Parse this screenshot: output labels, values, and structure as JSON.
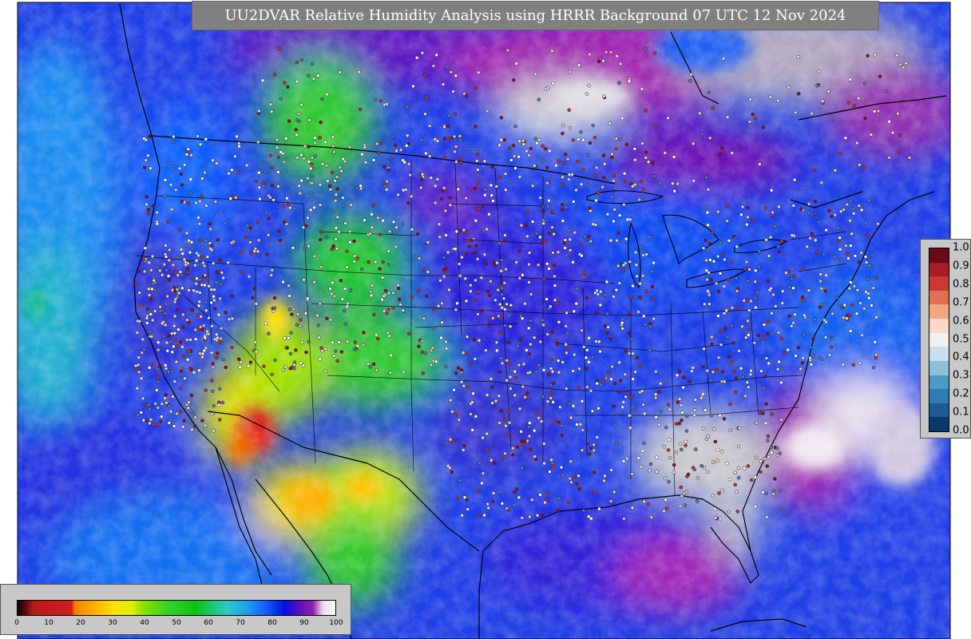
{
  "title": "UU2DVAR Relative Humidity Analysis using HRRR Background 07 UTC 12 Nov 2024",
  "rh_colorbar": {
    "ticks": [
      "0",
      "10",
      "20",
      "30",
      "40",
      "50",
      "60",
      "70",
      "80",
      "90",
      "100"
    ],
    "stops": [
      {
        "value": 0,
        "color": "#100006"
      },
      {
        "value": 3,
        "color": "#6a1010"
      },
      {
        "value": 5,
        "color": "#b81818"
      },
      {
        "value": 17,
        "color": "#d02020"
      },
      {
        "value": 18,
        "color": "#f08000"
      },
      {
        "value": 23,
        "color": "#ffa500"
      },
      {
        "value": 30,
        "color": "#ffe000"
      },
      {
        "value": 36,
        "color": "#d8f000"
      },
      {
        "value": 40,
        "color": "#80e000"
      },
      {
        "value": 48,
        "color": "#30d030"
      },
      {
        "value": 56,
        "color": "#10c010"
      },
      {
        "value": 62,
        "color": "#20c880"
      },
      {
        "value": 66,
        "color": "#30c8c8"
      },
      {
        "value": 72,
        "color": "#20a0e8"
      },
      {
        "value": 78,
        "color": "#1060ff"
      },
      {
        "value": 84,
        "color": "#0010e0"
      },
      {
        "value": 88,
        "color": "#5010c0"
      },
      {
        "value": 93,
        "color": "#9020b0"
      },
      {
        "value": 96,
        "color": "#e8d8e8"
      },
      {
        "value": 100,
        "color": "#ffffff"
      }
    ]
  },
  "increment_colorbar": {
    "ticks": [
      "0.0",
      "0.1",
      "0.2",
      "0.3",
      "0.4",
      "0.5",
      "0.6",
      "0.7",
      "0.8",
      "0.9",
      "1.0"
    ],
    "colors": [
      "#0a3a6b",
      "#1d5c93",
      "#2f7bb5",
      "#4a9bc6",
      "#8cbfd8",
      "#c8dfeb",
      "#f0f0f0",
      "#fad8c8",
      "#f4a582",
      "#e07050",
      "#c83a30",
      "#a51c24",
      "#6a0a18"
    ]
  }
}
